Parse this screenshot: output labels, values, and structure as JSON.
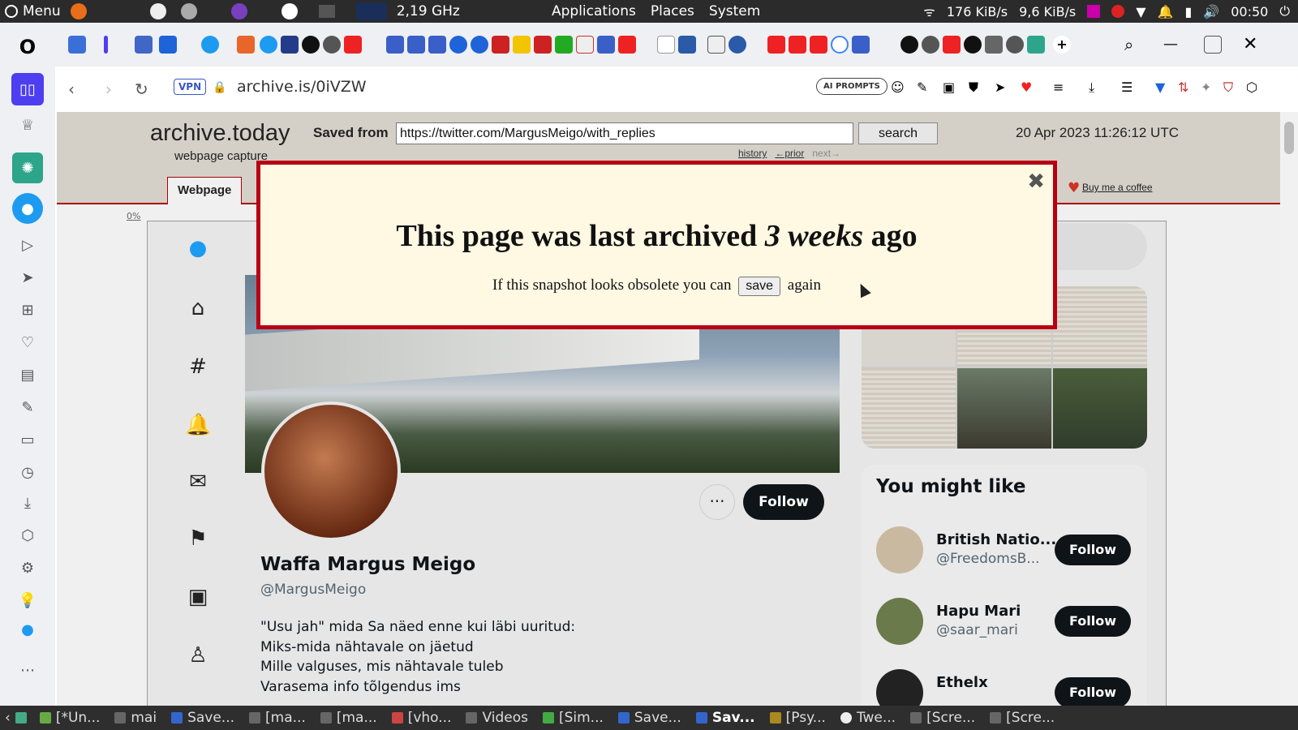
{
  "system": {
    "menu_label": "Menu",
    "cpu": "2,19 GHz",
    "applications": "Applications",
    "places": "Places",
    "system": "System",
    "net": "176 KiB/s",
    "net_up": "9,6 KiB/s",
    "clock": "00:50"
  },
  "browser": {
    "vpn": "VPN",
    "url": "archive.is/0iVZW",
    "ai_prompts": "AI PROMPTS"
  },
  "archive": {
    "logo": "archive.today",
    "logo_sub": "webpage capture",
    "saved_from_label": "Saved from",
    "source_url": "https://twitter.com/MargusMeigo/with_replies",
    "search_button": "search",
    "date": "20 Apr 2023 11:26:12 UTC",
    "history": "history",
    "prior": "←prior",
    "next": "next→",
    "tab_webpage": "Webpage",
    "buy_coffee": "Buy me a coffee",
    "percent": "0%"
  },
  "modal": {
    "title_pre": "This page was last archived",
    "title_em": "3 weeks",
    "title_post": "ago",
    "body_pre": "If this snapshot looks obsolete you can",
    "save_button": "save",
    "body_post": "again"
  },
  "profile": {
    "follow": "Follow",
    "more": "···",
    "name": "Waffa Margus Meigo",
    "handle": "@MargusMeigo",
    "bio_lines": [
      "\"Usu jah\" mida Sa näed enne kui läbi uuritud:",
      "Miks-mida nähtavale on jäetud",
      "Mille valguses, mis nähtavale tuleb",
      "Varasema info tõlgendus ims"
    ]
  },
  "suggestions": {
    "title": "You might like",
    "items": [
      {
        "name": "British Natio...",
        "handle": "@FreedomsB...",
        "follow": "Follow"
      },
      {
        "name": "Hapu Mari",
        "handle": "@saar_mari",
        "follow": "Follow"
      },
      {
        "name": "Ethelx",
        "handle": "",
        "follow": "Follow"
      }
    ]
  },
  "taskbar": {
    "items": [
      "[*Un...",
      "mai",
      "Save...",
      "[ma...",
      "[ma...",
      "[vho...",
      "Videos",
      "[Sim...",
      "Save...",
      "Sav...",
      "[Psy...",
      "Twe...",
      "[Scre...",
      "[Scre..."
    ]
  },
  "colors": {
    "modal_border": "#b80014",
    "modal_bg": "#fff8e3",
    "archive_header": "#d4d0c8",
    "twitter_blue": "#1d9bf0",
    "follow_bg": "#0f1419"
  }
}
